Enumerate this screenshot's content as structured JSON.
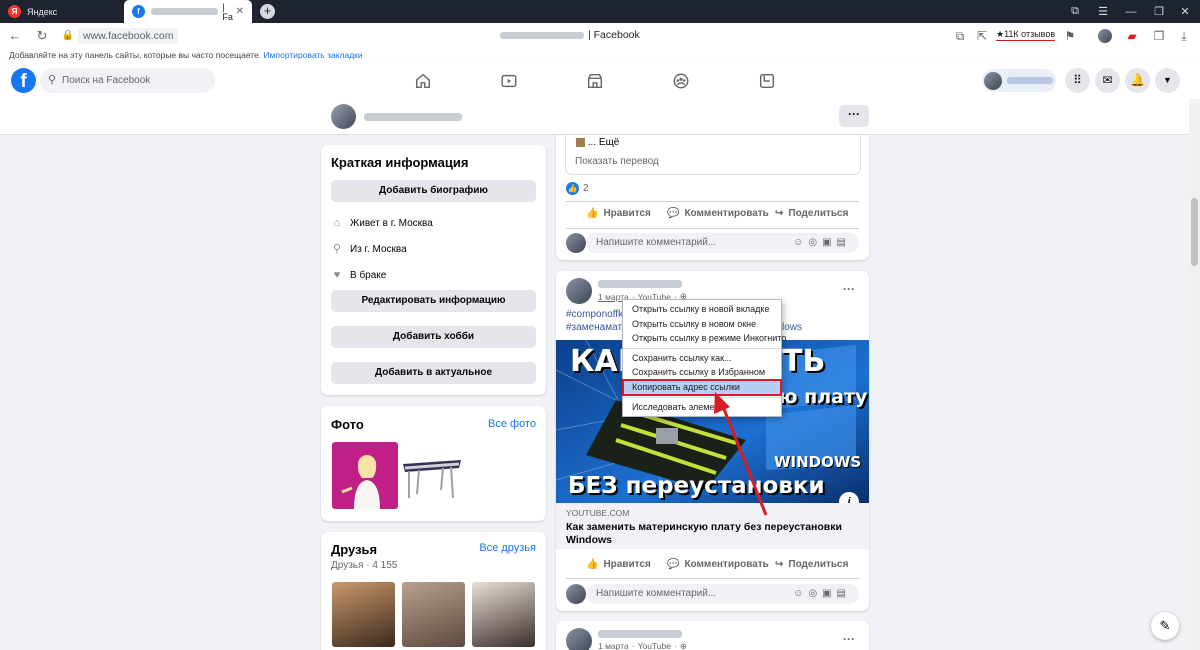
{
  "browser": {
    "tabs": [
      {
        "label": "Яндекс",
        "icon": "yandex-browser-icon"
      },
      {
        "label": "| Fa",
        "icon": "facebook-icon"
      }
    ],
    "url": "www.facebook.com",
    "window_title_suffix": "| Facebook",
    "reviews_badge": "★11К отзывов",
    "bookmark_hint": "Добавляйте на эту панель сайты, которые вы часто посещаете.",
    "bookmark_import_link": "Импортировать закладки"
  },
  "facebook": {
    "logo": "f",
    "search_placeholder": "Поиск на Facebook",
    "nav_icons": [
      "home-icon",
      "watch-icon",
      "marketplace-icon",
      "groups-icon",
      "gaming-icon"
    ],
    "header_buttons": [
      "menu-grid-icon",
      "messenger-icon",
      "notifications-icon",
      "account-dropdown-icon"
    ]
  },
  "profile_bar": {
    "more_button": "···"
  },
  "intro": {
    "title": "Краткая информация",
    "add_bio": "Добавить биографию",
    "lives_in": "Живет в г. Москва",
    "from": "Из г. Москва",
    "relationship": "В браке",
    "edit_info": "Редактировать информацию",
    "add_hobbies": "Добавить хобби",
    "add_featured": "Добавить в актуальное"
  },
  "photos": {
    "title": "Фото",
    "see_all": "Все фото"
  },
  "friends": {
    "title": "Друзья",
    "see_all": "Все друзья",
    "count": "Друзья · 4 155"
  },
  "post1": {
    "more_text": "... Ещё",
    "translate": "Показать перевод",
    "likes_count": "2",
    "like": "Нравится",
    "comment": "Комментировать",
    "share": "Поделиться",
    "comment_placeholder": "Напишите комментарий..."
  },
  "post2": {
    "date": "1 марта",
    "source": "YouTube",
    "hashtag1": "#componoffk",
    "hashtag2": "#заменамате",
    "hashtag2_tail": "lows",
    "thumb_line1": "КАК",
    "thumb_line1b": "ТЬ",
    "thumb_line2": "ю плату",
    "thumb_windows": "WINDOWS",
    "thumb_line3": "БЕЗ переустановки",
    "link_domain": "YOUTUBE.COM",
    "link_title": "Как заменить материнскую плату без переустановки Windows",
    "like": "Нравится",
    "comment": "Комментировать",
    "share": "Поделиться",
    "comment_placeholder": "Напишите комментарий..."
  },
  "post3": {
    "date": "1 марта",
    "source": "YouTube"
  },
  "context_menu": {
    "items": [
      "Открыть ссылку в новой вкладке",
      "Открыть ссылку в новом окне",
      "Открыть ссылку в режиме Инкогнито",
      "Сохранить ссылку как...",
      "Сохранить ссылку в Избранном",
      "Копировать адрес ссылки",
      "Исследовать элемент"
    ],
    "highlighted_index": 5,
    "highlight_color": "#d91b24"
  }
}
